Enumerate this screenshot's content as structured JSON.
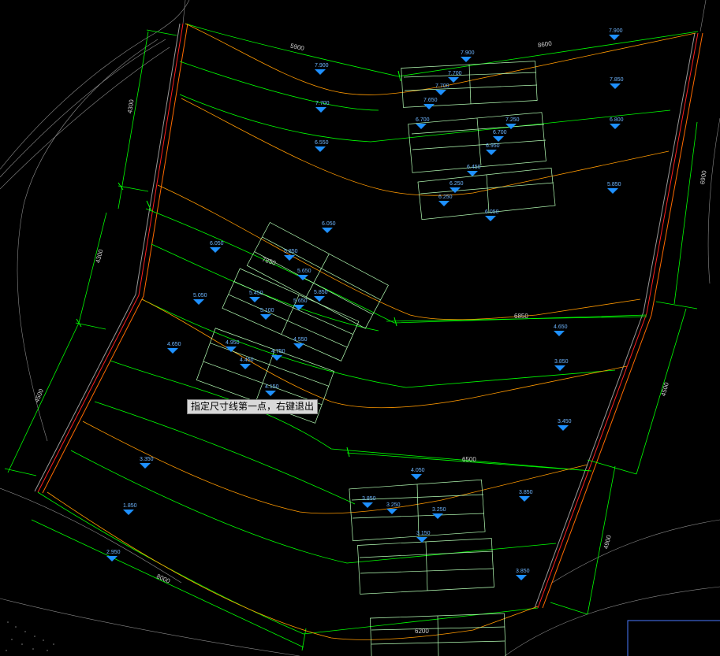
{
  "prompt": {
    "text": "指定尺寸线第一点，右键退出"
  },
  "dimensions": {
    "top_a": "5900",
    "top_b": "8600",
    "right_top": "6900",
    "left_top": "4300",
    "left_mid": "4300",
    "left_bot": "4500",
    "mid_a": "7850",
    "mid_b": "6850",
    "row_c": "6500",
    "right_bot": "4500",
    "right_low": "4900",
    "bottom_a": "8000",
    "bottom_b": "6200"
  },
  "elevations": [
    "7.900",
    "7.900",
    "7.900",
    "7.700",
    "7.850",
    "7.700",
    "7.650",
    "7.700",
    "6.700",
    "7.250",
    "6.800",
    "6.700",
    "6.950",
    "6.550",
    "6.450",
    "6.250",
    "6.250",
    "5.850",
    "6.050",
    "6.050",
    "6.050",
    "5.850",
    "5.650",
    "5.850",
    "5.050",
    "5.450",
    "5.650",
    "5.100",
    "4.650",
    "4.950",
    "4.550",
    "4.750",
    "4.450",
    "4.650",
    "3.850",
    "4.150",
    "3.450",
    "3.350",
    "4.050",
    "3.850",
    "3.850",
    "3.250",
    "3.250",
    "1.850",
    "3.150",
    "2.950",
    "3.850"
  ],
  "colors": {
    "background": "#000000",
    "boundary": "#00ff00",
    "contour": "#ff9900",
    "wall": "#ff2020",
    "terrain": "#ffffff",
    "marker": "#1e90ff",
    "tooltip_bg": "#d9d9d9"
  }
}
